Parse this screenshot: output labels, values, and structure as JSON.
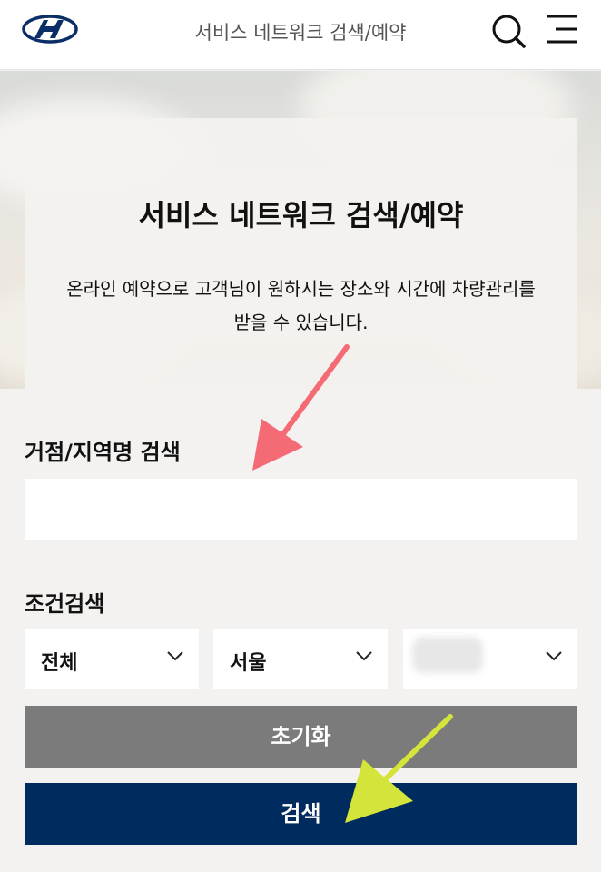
{
  "header": {
    "title": "서비스 네트워크 검색/예약"
  },
  "hero": {
    "title": "서비스 네트워크 검색/예약",
    "description_line1": "온라인 예약으로 고객님이 원하시는 장소와 시간에 차량관리를",
    "description_line2": "받을 수 있습니다."
  },
  "search": {
    "label": "거점/지역명 검색",
    "value": "",
    "placeholder": ""
  },
  "filters": {
    "label": "조건검색",
    "type_select": {
      "value": "전체"
    },
    "region_select": {
      "value": "서울"
    },
    "district_select": {
      "value": ""
    }
  },
  "buttons": {
    "reset_label": "초기화",
    "search_label": "검색"
  },
  "colors": {
    "primary": "#002b5e",
    "reset": "#7b7b7b",
    "annotation_red": "#f46b76",
    "annotation_yellow": "#d4e43a"
  },
  "icons": {
    "logo": "hyundai-logo-icon",
    "search": "search-icon",
    "menu": "hamburger-menu-icon",
    "dropdown": "chevron-down-icon"
  }
}
